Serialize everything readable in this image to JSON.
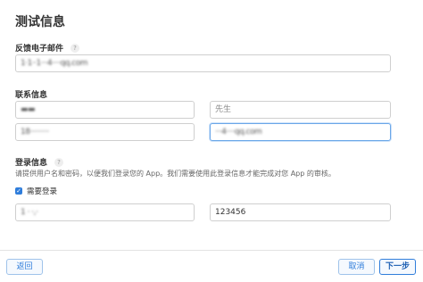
{
  "page_title": "测试信息",
  "feedback": {
    "label": "反馈电子邮件",
    "help": "?",
    "value": "1·1··1···4····qq.com"
  },
  "contact": {
    "label": "联系信息",
    "last_name_value": "▬▬",
    "first_name_placeholder": "先生",
    "phone_value": "18·········",
    "email_value": "···4····qq.com"
  },
  "login": {
    "label": "登录信息",
    "help": "?",
    "description": "请提供用户名和密码，以便我们登录您的 App。我们需要使用此登录信息才能完成对您 App 的审核。",
    "require_login_label": "需要登录",
    "checkbox_mark": "✓",
    "username_value": "1 · ·,·",
    "password_value": "123456"
  },
  "footer": {
    "back_label": "返回",
    "cancel_label": "取消",
    "next_label": "下一步"
  }
}
